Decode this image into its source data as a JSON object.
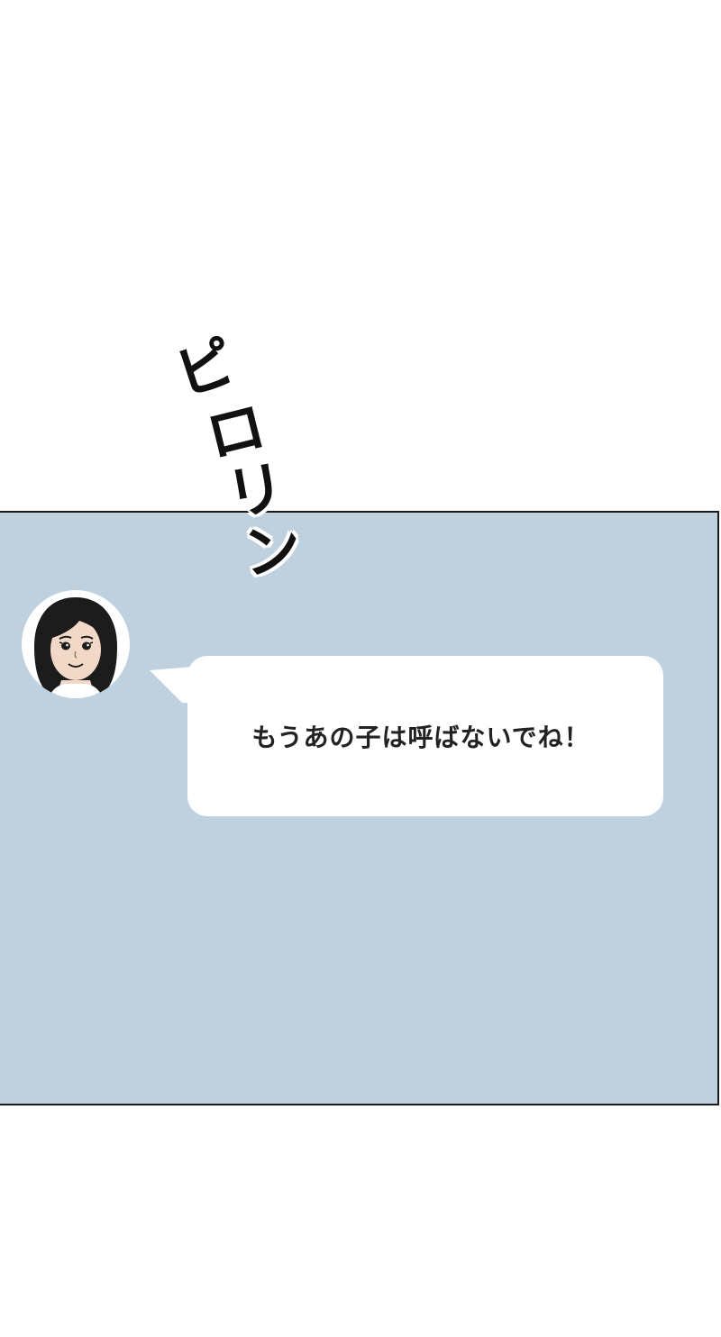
{
  "sfx": {
    "text": "ピロリン",
    "chars": [
      "ピ",
      "ロ",
      "リ",
      "ン"
    ]
  },
  "message": {
    "text": "もうあの子は呼ばないでね！"
  },
  "avatar": {
    "icon": "woman-avatar-icon"
  },
  "colors": {
    "panel_background": "#bfd1de",
    "page_background": "#ffffff",
    "bubble_background": "#ffffff",
    "text": "#222222"
  }
}
